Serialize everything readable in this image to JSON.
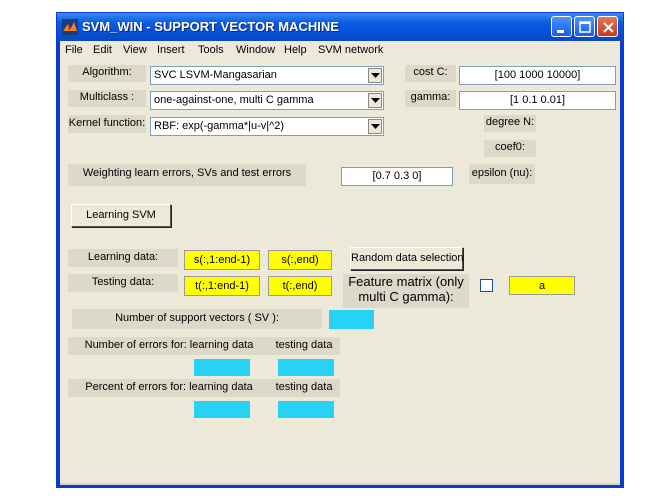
{
  "window": {
    "title": "SVM_WIN - SUPPORT VECTOR MACHINE"
  },
  "menu": [
    "File",
    "Edit",
    "View",
    "Insert",
    "Tools",
    "Window",
    "Help",
    "SVM network"
  ],
  "algorithm": {
    "label": "Algorithm:",
    "value": "SVC LSVM-Mangasarian"
  },
  "multiclass": {
    "label": "Multiclass :",
    "value": "one-against-one, multi C gamma"
  },
  "kernel": {
    "label": "Kernel function:",
    "value": "RBF: exp(-gamma*|u-v|^2)"
  },
  "cost": {
    "label": "cost C:",
    "value": "[100 1000 10000]"
  },
  "gamma": {
    "label": "gamma:",
    "value": "[1 0.1 0.01]"
  },
  "degree_label": "degree N:",
  "coef0_label": "coef0:",
  "weighting": {
    "label": "Weighting learn errors, SVs and test errors",
    "value": "[0.7 0.3 0]"
  },
  "epsilon_label": "epsilon (nu):",
  "learn_button": "Learning SVM",
  "learning_data": {
    "label": "Learning data:",
    "x": "s(:,1:end-1)",
    "y": "s(:,end)"
  },
  "testing_data": {
    "label": "Testing data:",
    "x": "t(:,1:end-1)",
    "y": "t(:,end)"
  },
  "random_button": "Random data selection",
  "feature_matrix": {
    "label": "Feature matrix (only multi C gamma):",
    "value": "a",
    "checked": false
  },
  "sv_label": "Number of support vectors ( SV ):",
  "errors": {
    "label": "Number of errors for: learning data",
    "testing": "testing data"
  },
  "percent": {
    "label": "Percent of errors for: learning data",
    "testing": "testing data"
  },
  "colors": {
    "title_bar": "#0b5be0",
    "panel": "#ece9d8",
    "highlight": "#ffff00",
    "result": "#28d2f7"
  }
}
